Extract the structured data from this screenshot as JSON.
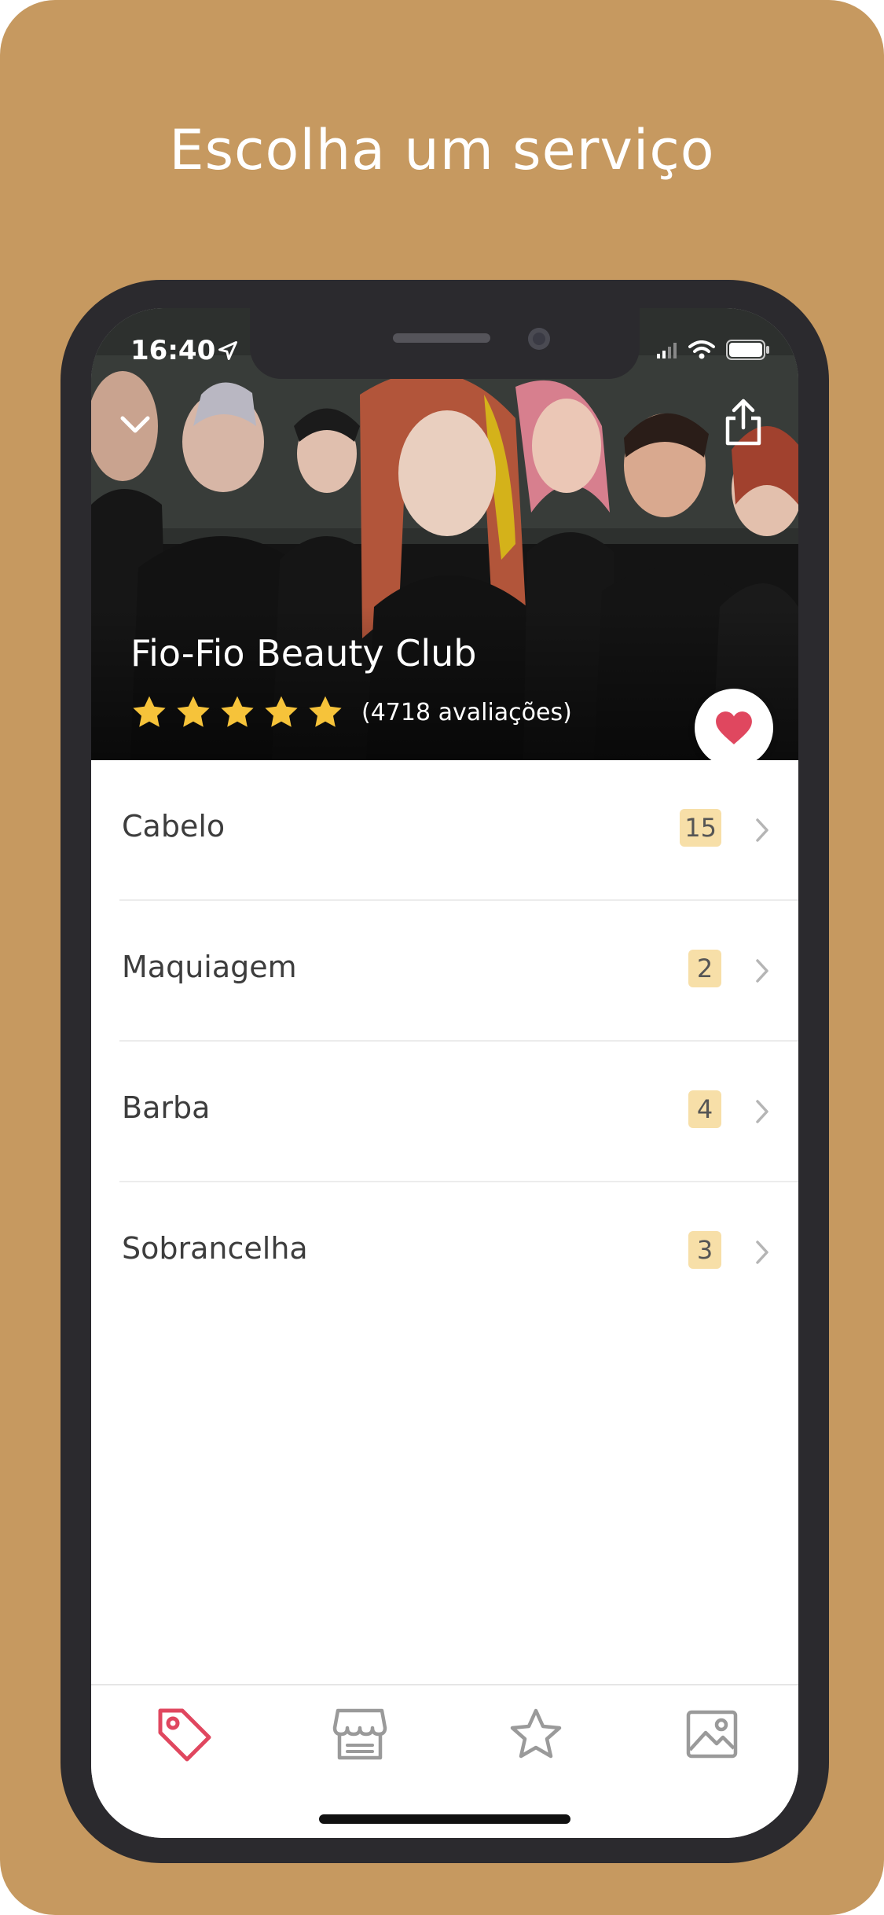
{
  "page": {
    "headline": "Escolha um serviço"
  },
  "status_bar": {
    "time": "16:40"
  },
  "salon": {
    "name": "Fio-Fio Beauty Club",
    "rating": 5,
    "reviews": "(4718 avaliações)"
  },
  "categories": [
    {
      "label": "Cabelo",
      "count": "15"
    },
    {
      "label": "Maquiagem",
      "count": "2"
    },
    {
      "label": "Barba",
      "count": "4"
    },
    {
      "label": "Sobrancelha",
      "count": "3"
    }
  ],
  "tabbar": {
    "tabs": [
      {
        "icon": "tag-icon",
        "active": true
      },
      {
        "icon": "store-icon",
        "active": false
      },
      {
        "icon": "star-icon",
        "active": false
      },
      {
        "icon": "image-icon",
        "active": false
      }
    ]
  },
  "colors": {
    "background": "#c69960",
    "accent": "#e0475f",
    "star": "#f6c33a",
    "badge": "#f7dfa8",
    "inactive_icon": "#9a9a9a"
  }
}
